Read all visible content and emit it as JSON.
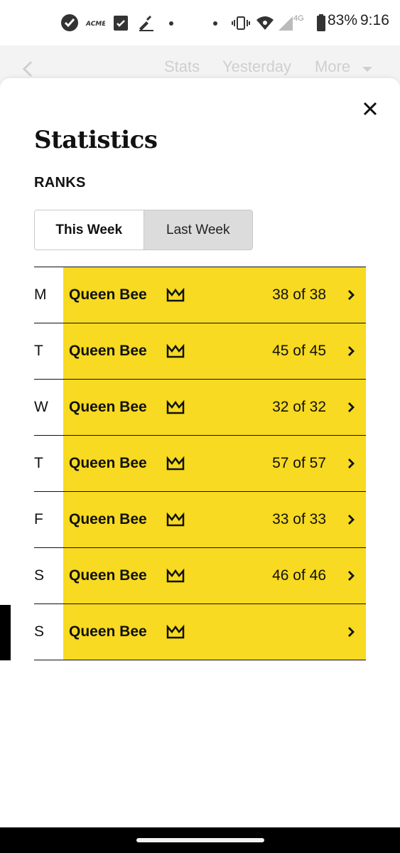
{
  "status_bar": {
    "icons": [
      "check-circle-icon",
      "acme-icon",
      "calendar-icon",
      "signature-icon",
      "dot-icon",
      "dot-icon",
      "vibrate-icon",
      "wifi-icon",
      "signal-icon",
      "battery-icon"
    ],
    "network": "4G",
    "battery": "83%",
    "time": "9:16"
  },
  "underlay": {
    "back_icon": "chevron-left-icon",
    "nav": [
      "Stats",
      "Yesterday",
      "More"
    ]
  },
  "sheet": {
    "title": "Statistics",
    "section_label": "RANKS",
    "tabs": [
      {
        "label": "This Week",
        "selected": true
      },
      {
        "label": "Last Week",
        "selected": false
      }
    ],
    "rows": [
      {
        "day": "M",
        "rank": "Queen Bee",
        "score": "38 of 38"
      },
      {
        "day": "T",
        "rank": "Queen Bee",
        "score": "45 of 45"
      },
      {
        "day": "W",
        "rank": "Queen Bee",
        "score": "32 of 32"
      },
      {
        "day": "T",
        "rank": "Queen Bee",
        "score": "57 of 57"
      },
      {
        "day": "F",
        "rank": "Queen Bee",
        "score": "33 of 33"
      },
      {
        "day": "S",
        "rank": "Queen Bee",
        "score": "46 of 46"
      },
      {
        "day": "S",
        "rank": "Queen Bee",
        "score": ""
      }
    ]
  },
  "colors": {
    "accent_yellow": "#f7da21",
    "text": "#111111"
  }
}
